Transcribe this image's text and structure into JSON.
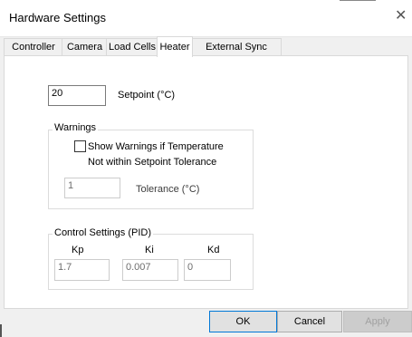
{
  "window": {
    "title": "Hardware Settings",
    "close_glyph": "✕"
  },
  "tabs": [
    {
      "label": "Controller"
    },
    {
      "label": "Camera"
    },
    {
      "label": "Load Cells"
    },
    {
      "label": "Heater",
      "active": true
    },
    {
      "label": "External Sync Pulse"
    }
  ],
  "setpoint": {
    "value": "20",
    "label": "Setpoint (°C)"
  },
  "warnings": {
    "group_title": "Warnings",
    "checkbox_line1": "Show Warnings if Temperature",
    "checkbox_line2": "Not within Setpoint Tolerance",
    "checked": false,
    "tolerance_value": "1",
    "tolerance_label": "Tolerance (°C)"
  },
  "pid": {
    "group_title": "Control Settings (PID)",
    "kp_label": "Kp",
    "kp_value": "1.7",
    "ki_label": "Ki",
    "ki_value": "0.007",
    "kd_label": "Kd",
    "kd_value": "0"
  },
  "buttons": {
    "ok": "OK",
    "cancel": "Cancel",
    "apply": "Apply"
  },
  "colors": {
    "accent": "#0078d7",
    "dialog_bg": "#f0f0f0",
    "panel_bg": "#ffffff"
  },
  "icons": {
    "close": "close-icon",
    "checkbox": "checkbox"
  }
}
